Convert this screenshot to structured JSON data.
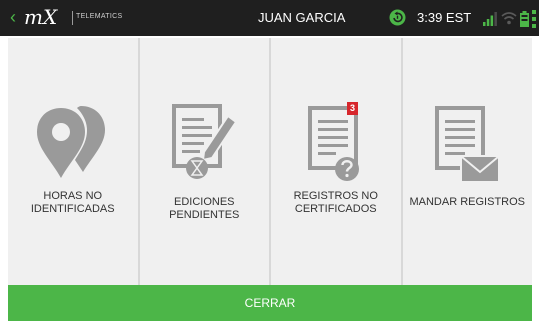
{
  "statusbar": {
    "back_glyph": "‹",
    "logo": "mX",
    "logo_subtitle": "TELEMATICS",
    "driver_name": "JUAN GARCIA",
    "time": "3:39 EST"
  },
  "tiles": [
    {
      "label": "HORAS NO\nIDENTIFICADAS",
      "icon": "location-pins-icon"
    },
    {
      "label": "EDICIONES PENDIENTES",
      "icon": "document-edit-hourglass-icon"
    },
    {
      "label": "REGISTROS NO\nCERTIFICADOS",
      "icon": "document-question-icon",
      "badge": "3"
    },
    {
      "label": "MANDAR REGISTROS",
      "icon": "document-envelope-icon"
    }
  ],
  "close_button": {
    "label": "CERRAR"
  },
  "colors": {
    "topbar": "#1f1f1f",
    "accent_green": "#4cb648",
    "tile_background": "#f0f0f0",
    "icon_gray": "#9a9a9a",
    "badge_red": "#d7262c"
  }
}
